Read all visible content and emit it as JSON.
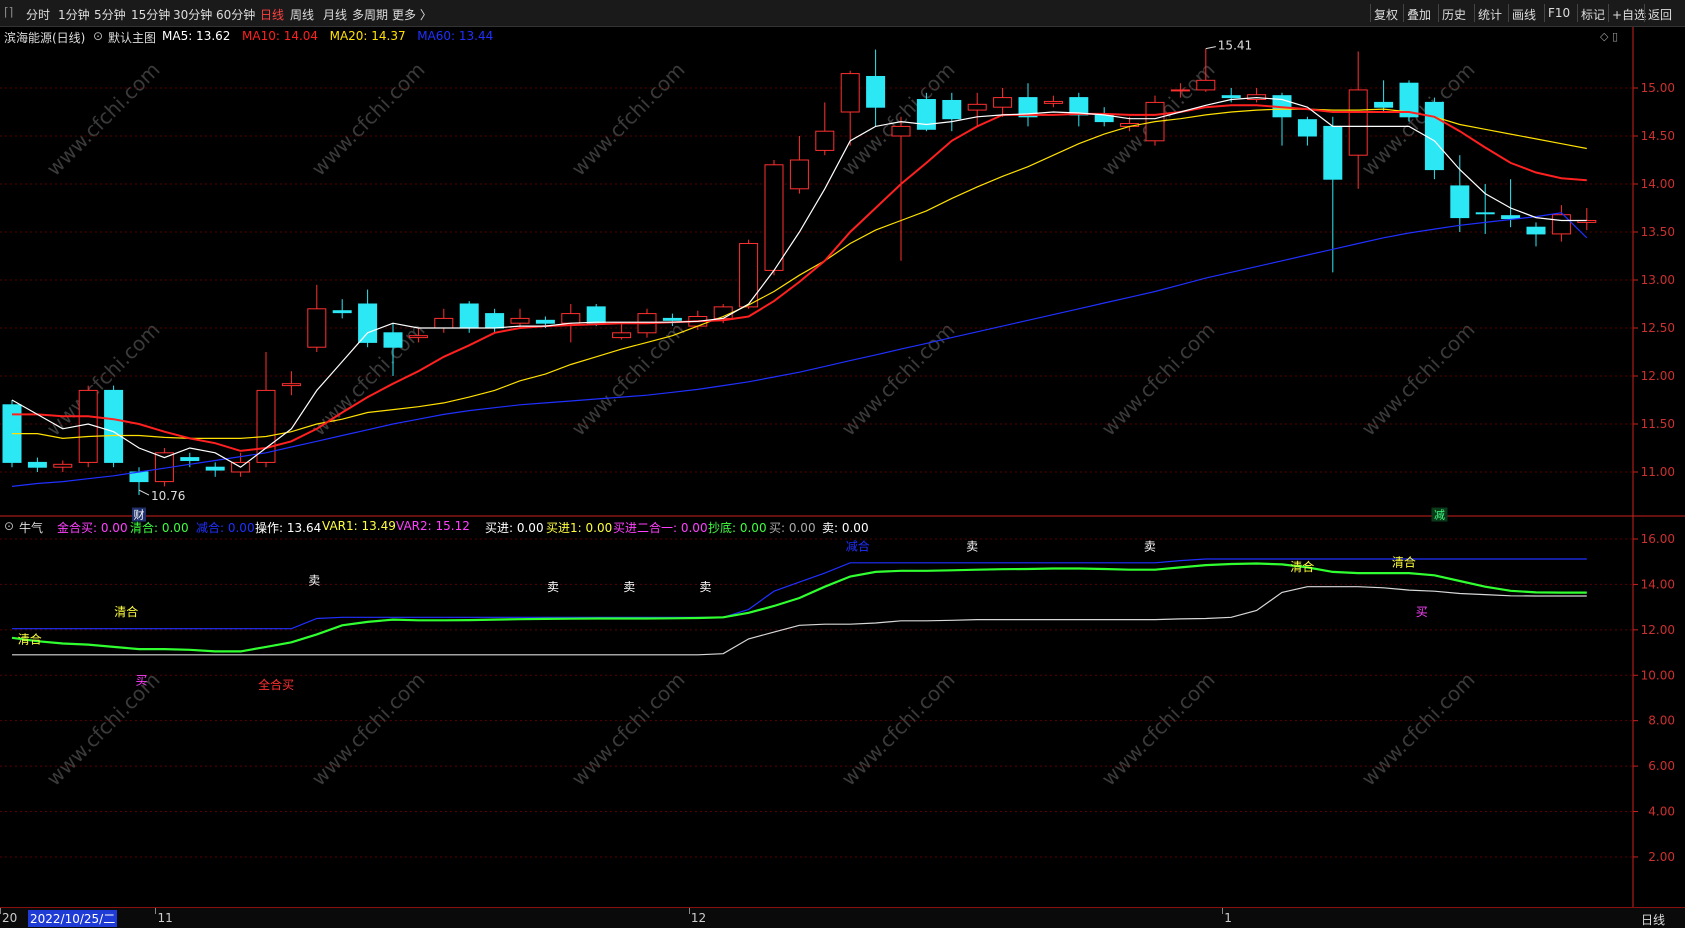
{
  "toolbar": {
    "timeframes": [
      "分时",
      "1分钟",
      "5分钟",
      "15分钟",
      "30分钟",
      "60分钟",
      "日线",
      "周线",
      "月线",
      "多周期",
      "更多 〉"
    ],
    "active_timeframe": "日线",
    "right_buttons": [
      "复权",
      "叠加",
      "历史",
      "统计",
      "画线",
      "F10",
      "标记",
      "+自选",
      "返回"
    ]
  },
  "main_header": {
    "title": "滨海能源(日线)",
    "template": "默认主图",
    "ma": [
      {
        "label": "MA5: 13.62",
        "color": "#ffffff"
      },
      {
        "label": "MA10: 14.04",
        "color": "#ff2020"
      },
      {
        "label": "MA20: 14.37",
        "color": "#ffe000"
      },
      {
        "label": "MA60: 13.44",
        "color": "#2030ff"
      }
    ]
  },
  "indicator_header": {
    "name": "牛气",
    "items": [
      {
        "label": "金合买: 0.00",
        "color": "#ff40ff"
      },
      {
        "label": "清合: 0.00",
        "color": "#40ff40"
      },
      {
        "label": "减合: 0.00",
        "color": "#2030ff"
      },
      {
        "label": "操作: 13.64",
        "color": "#ffffff"
      },
      {
        "label": "VAR1: 13.49",
        "color": "#ffff40"
      },
      {
        "label": "VAR2: 15.12",
        "color": "#ff40ff"
      },
      {
        "label": "买进: 0.00",
        "color": "#ffffff"
      },
      {
        "label": "买进1: 0.00",
        "color": "#ffff40"
      },
      {
        "label": "买进二合一: 0.00",
        "color": "#ff40ff"
      },
      {
        "label": "抄底: 0.00",
        "color": "#40ff40"
      },
      {
        "label": "买: 0.00",
        "color": "#aaaaaa"
      },
      {
        "label": "卖: 0.00",
        "color": "#ffffff"
      }
    ]
  },
  "colors": {
    "up": "#ff3030",
    "down": "#2ce8f5",
    "ma5": "#ffffff",
    "ma10": "#ff2020",
    "ma20": "#ffe000",
    "ma60": "#2030ff",
    "grid": "#5a0000",
    "axis": "#cc2020"
  },
  "chart_data": [
    {
      "type": "candlestick",
      "title": "滨海能源(日线)",
      "ylim": [
        10.6,
        15.4
      ],
      "yticks": [
        "15.00",
        "14.50",
        "14.00",
        "13.50",
        "13.00",
        "12.50",
        "12.00",
        "11.50",
        "11.00"
      ],
      "annotations": {
        "high": "15.41",
        "low": "10.76",
        "low_marker": "财",
        "signal": "减"
      },
      "candles": [
        [
          11.7,
          11.1,
          11.75,
          11.05
        ],
        [
          11.1,
          11.05,
          11.15,
          11.0
        ],
        [
          11.05,
          11.08,
          11.12,
          11.0
        ],
        [
          11.1,
          11.85,
          11.9,
          11.05
        ],
        [
          11.85,
          11.1,
          11.9,
          11.05
        ],
        [
          11.0,
          10.9,
          11.05,
          10.76
        ],
        [
          10.9,
          11.2,
          11.25,
          10.85
        ],
        [
          11.15,
          11.12,
          11.2,
          11.05
        ],
        [
          11.05,
          11.02,
          11.1,
          10.95
        ],
        [
          11.0,
          11.1,
          11.2,
          10.95
        ],
        [
          11.1,
          11.85,
          12.25,
          11.05
        ],
        [
          11.9,
          11.92,
          12.05,
          11.8
        ],
        [
          12.3,
          12.7,
          12.95,
          12.25
        ],
        [
          12.68,
          12.66,
          12.8,
          12.6
        ],
        [
          12.75,
          12.35,
          12.9,
          12.3
        ],
        [
          12.45,
          12.3,
          12.55,
          12.0
        ],
        [
          12.4,
          12.42,
          12.5,
          12.35
        ],
        [
          12.5,
          12.6,
          12.7,
          12.45
        ],
        [
          12.75,
          12.5,
          12.78,
          12.45
        ],
        [
          12.65,
          12.5,
          12.7,
          12.45
        ],
        [
          12.55,
          12.6,
          12.7,
          12.5
        ],
        [
          12.58,
          12.55,
          12.62,
          12.5
        ],
        [
          12.55,
          12.65,
          12.75,
          12.35
        ],
        [
          12.72,
          12.55,
          12.75,
          12.52
        ],
        [
          12.4,
          12.45,
          12.55,
          12.38
        ],
        [
          12.45,
          12.65,
          12.7,
          12.4
        ],
        [
          12.6,
          12.58,
          12.65,
          12.52
        ],
        [
          12.52,
          12.62,
          12.68,
          12.48
        ],
        [
          12.6,
          12.72,
          12.75,
          12.55
        ],
        [
          12.72,
          13.38,
          13.42,
          12.7
        ],
        [
          13.1,
          14.2,
          14.25,
          13.05
        ],
        [
          13.95,
          14.25,
          14.5,
          13.9
        ],
        [
          14.35,
          14.55,
          14.85,
          14.3
        ],
        [
          14.75,
          15.15,
          15.18,
          14.4
        ],
        [
          15.12,
          14.8,
          15.4,
          14.6
        ],
        [
          14.5,
          14.6,
          14.7,
          13.2
        ],
        [
          14.88,
          14.57,
          14.95,
          14.55
        ],
        [
          14.87,
          14.68,
          14.95,
          14.55
        ],
        [
          14.77,
          14.83,
          14.95,
          14.6
        ],
        [
          14.8,
          14.9,
          15.0,
          14.7
        ],
        [
          14.9,
          14.7,
          15.05,
          14.6
        ],
        [
          14.84,
          14.86,
          14.92,
          14.8
        ],
        [
          14.9,
          14.72,
          14.95,
          14.6
        ],
        [
          14.72,
          14.65,
          14.8,
          14.6
        ],
        [
          14.6,
          14.63,
          14.7,
          14.55
        ],
        [
          14.45,
          14.85,
          14.92,
          14.4
        ],
        [
          14.97,
          14.98,
          15.05,
          14.9
        ],
        [
          14.98,
          15.08,
          15.41,
          14.96
        ],
        [
          14.92,
          14.9,
          15.0,
          14.85
        ],
        [
          14.88,
          14.93,
          15.0,
          14.85
        ],
        [
          14.92,
          14.7,
          14.95,
          14.4
        ],
        [
          14.67,
          14.5,
          14.7,
          14.4
        ],
        [
          14.6,
          14.05,
          14.7,
          13.08
        ],
        [
          14.3,
          14.98,
          15.38,
          13.95
        ],
        [
          14.85,
          14.8,
          15.08,
          14.75
        ],
        [
          15.05,
          14.7,
          15.08,
          14.65
        ],
        [
          14.85,
          14.15,
          14.9,
          14.05
        ],
        [
          13.98,
          13.65,
          14.3,
          13.5
        ],
        [
          13.7,
          13.69,
          14.0,
          13.48
        ],
        [
          13.67,
          13.64,
          14.05,
          13.55
        ],
        [
          13.55,
          13.48,
          13.6,
          13.35
        ],
        [
          13.48,
          13.68,
          13.78,
          13.4
        ],
        [
          13.6,
          13.62,
          13.75,
          13.52
        ]
      ],
      "ma5": [
        11.75,
        11.6,
        11.45,
        11.5,
        11.42,
        11.25,
        11.15,
        11.25,
        11.2,
        11.05,
        11.25,
        11.45,
        11.85,
        12.15,
        12.45,
        12.55,
        12.5,
        12.5,
        12.5,
        12.5,
        12.52,
        12.52,
        12.55,
        12.56,
        12.56,
        12.56,
        12.56,
        12.57,
        12.6,
        12.75,
        13.1,
        13.5,
        13.95,
        14.45,
        14.6,
        14.65,
        14.62,
        14.65,
        14.7,
        14.72,
        14.73,
        14.75,
        14.74,
        14.72,
        14.68,
        14.68,
        14.75,
        14.82,
        14.88,
        14.9,
        14.88,
        14.8,
        14.6,
        14.6,
        14.6,
        14.6,
        14.45,
        14.15,
        13.9,
        13.75,
        13.65,
        13.62,
        13.62
      ],
      "ma10": [
        11.6,
        11.6,
        11.58,
        11.58,
        11.55,
        11.5,
        11.42,
        11.35,
        11.3,
        11.22,
        11.25,
        11.32,
        11.45,
        11.62,
        11.78,
        11.92,
        12.05,
        12.2,
        12.32,
        12.45,
        12.5,
        12.52,
        12.53,
        12.54,
        12.55,
        12.55,
        12.56,
        12.57,
        12.58,
        12.62,
        12.78,
        12.98,
        13.2,
        13.5,
        13.75,
        14.0,
        14.22,
        14.45,
        14.6,
        14.72,
        14.72,
        14.72,
        14.73,
        14.73,
        14.72,
        14.72,
        14.75,
        14.8,
        14.82,
        14.82,
        14.8,
        14.78,
        14.75,
        14.75,
        14.75,
        14.75,
        14.7,
        14.55,
        14.38,
        14.22,
        14.12,
        14.06,
        14.04
      ],
      "ma20": [
        11.4,
        11.4,
        11.35,
        11.37,
        11.38,
        11.38,
        11.36,
        11.35,
        11.35,
        11.35,
        11.37,
        11.42,
        11.5,
        11.55,
        11.62,
        11.65,
        11.68,
        11.72,
        11.78,
        11.85,
        11.95,
        12.02,
        12.12,
        12.2,
        12.28,
        12.35,
        12.42,
        12.52,
        12.62,
        12.74,
        12.88,
        13.05,
        13.2,
        13.38,
        13.52,
        13.62,
        13.72,
        13.85,
        13.97,
        14.08,
        14.18,
        14.3,
        14.42,
        14.52,
        14.6,
        14.65,
        14.68,
        14.72,
        14.75,
        14.77,
        14.78,
        14.78,
        14.77,
        14.77,
        14.78,
        14.75,
        14.7,
        14.62,
        14.57,
        14.52,
        14.47,
        14.42,
        14.37
      ],
      "ma60": [
        10.85,
        10.88,
        10.9,
        10.93,
        10.96,
        11.0,
        11.04,
        11.08,
        11.12,
        11.16,
        11.2,
        11.26,
        11.32,
        11.38,
        11.44,
        11.5,
        11.55,
        11.6,
        11.64,
        11.67,
        11.7,
        11.72,
        11.74,
        11.76,
        11.78,
        11.8,
        11.83,
        11.86,
        11.9,
        11.94,
        11.99,
        12.04,
        12.1,
        12.16,
        12.22,
        12.28,
        12.34,
        12.4,
        12.46,
        12.52,
        12.58,
        12.64,
        12.7,
        12.76,
        12.82,
        12.88,
        12.95,
        13.02,
        13.08,
        13.14,
        13.2,
        13.26,
        13.32,
        13.38,
        13.44,
        13.49,
        13.53,
        13.57,
        13.6,
        13.63,
        13.66,
        13.7,
        13.44
      ]
    },
    {
      "type": "line",
      "title": "牛气",
      "ylim": [
        1.0,
        16.5
      ],
      "yticks": [
        "16.00",
        "14.00",
        "12.00",
        "10.00",
        "8.00",
        "6.00",
        "4.00",
        "2.00"
      ],
      "series": [
        {
          "name": "减合",
          "color": "#2030ff",
          "values": [
            12.05,
            12.05,
            12.05,
            12.05,
            12.05,
            12.05,
            12.05,
            12.05,
            12.05,
            12.05,
            12.05,
            12.05,
            12.5,
            12.55,
            12.55,
            12.55,
            12.55,
            12.55,
            12.55,
            12.55,
            12.55,
            12.55,
            12.55,
            12.55,
            12.55,
            12.55,
            12.55,
            12.55,
            12.55,
            12.9,
            13.7,
            14.1,
            14.5,
            14.95,
            14.95,
            14.95,
            14.95,
            14.95,
            14.95,
            14.95,
            14.95,
            14.95,
            14.95,
            14.95,
            14.95,
            14.95,
            15.05,
            15.12,
            15.12,
            15.12,
            15.12,
            15.12,
            15.12,
            15.12,
            15.12,
            15.12,
            15.12,
            15.12,
            15.12,
            15.12,
            15.12,
            15.12,
            15.12
          ]
        },
        {
          "name": "清合",
          "color": "#30ff30",
          "values": [
            11.65,
            11.5,
            11.4,
            11.35,
            11.25,
            11.15,
            11.15,
            11.12,
            11.05,
            11.05,
            11.25,
            11.45,
            11.8,
            12.2,
            12.35,
            12.45,
            12.42,
            12.42,
            12.43,
            12.45,
            12.47,
            12.48,
            12.49,
            12.5,
            12.5,
            12.5,
            12.51,
            12.52,
            12.55,
            12.75,
            13.05,
            13.4,
            13.9,
            14.35,
            14.55,
            14.6,
            14.6,
            14.62,
            14.65,
            14.67,
            14.68,
            14.7,
            14.7,
            14.68,
            14.65,
            14.65,
            14.75,
            14.85,
            14.9,
            14.92,
            14.88,
            14.75,
            14.55,
            14.5,
            14.5,
            14.5,
            14.4,
            14.15,
            13.9,
            13.72,
            13.65,
            13.64,
            13.64
          ]
        },
        {
          "name": "VAR1",
          "color": "#d8d8d8",
          "values": [
            10.9,
            10.9,
            10.9,
            10.9,
            10.9,
            10.9,
            10.9,
            10.9,
            10.9,
            10.9,
            10.9,
            10.9,
            10.9,
            10.9,
            10.9,
            10.9,
            10.9,
            10.9,
            10.9,
            10.9,
            10.9,
            10.9,
            10.9,
            10.9,
            10.9,
            10.9,
            10.9,
            10.9,
            10.95,
            11.6,
            11.9,
            12.2,
            12.25,
            12.25,
            12.3,
            12.4,
            12.4,
            12.42,
            12.45,
            12.45,
            12.45,
            12.45,
            12.45,
            12.45,
            12.45,
            12.45,
            12.48,
            12.5,
            12.55,
            12.85,
            13.65,
            13.9,
            13.9,
            13.9,
            13.85,
            13.75,
            13.7,
            13.6,
            13.55,
            13.5,
            13.49,
            13.49,
            13.49
          ]
        }
      ],
      "signals": [
        {
          "i": 0.7,
          "y": 11.4,
          "text": "清合",
          "color": "#ffff40"
        },
        {
          "i": 4.5,
          "y": 12.6,
          "text": "清合",
          "color": "#ffff40"
        },
        {
          "i": 5.1,
          "y": 9.6,
          "text": "买",
          "color": "#ff40ff"
        },
        {
          "i": 10.4,
          "y": 9.4,
          "text": "全合买",
          "color": "#ff3030"
        },
        {
          "i": 11.9,
          "y": 14.0,
          "text": "卖",
          "color": "#ffffff"
        },
        {
          "i": 21.3,
          "y": 13.7,
          "text": "卖",
          "color": "#ffffff"
        },
        {
          "i": 24.3,
          "y": 13.7,
          "text": "卖",
          "color": "#ffffff"
        },
        {
          "i": 27.3,
          "y": 13.7,
          "text": "卖",
          "color": "#ffffff"
        },
        {
          "i": 33.3,
          "y": 15.5,
          "text": "减合",
          "color": "#2030ff"
        },
        {
          "i": 37.8,
          "y": 15.5,
          "text": "卖",
          "color": "#ffffff"
        },
        {
          "i": 44.8,
          "y": 15.5,
          "text": "卖",
          "color": "#ffffff"
        },
        {
          "i": 50.8,
          "y": 14.6,
          "text": "清合",
          "color": "#ffff40"
        },
        {
          "i": 54.8,
          "y": 14.8,
          "text": "清合",
          "color": "#ffff40"
        },
        {
          "i": 55.5,
          "y": 12.6,
          "text": "买",
          "color": "#ff40ff"
        }
      ]
    }
  ],
  "axis": {
    "dates": [
      {
        "text": "20",
        "i": 0
      },
      {
        "text": "11",
        "i": 6.2
      },
      {
        "text": "12",
        "i": 27.2
      },
      {
        "text": "1",
        "i": 48.2
      }
    ],
    "cursor_date": "2022/10/25/二",
    "period_label": "日线"
  },
  "watermark": "www.cfchi.com"
}
